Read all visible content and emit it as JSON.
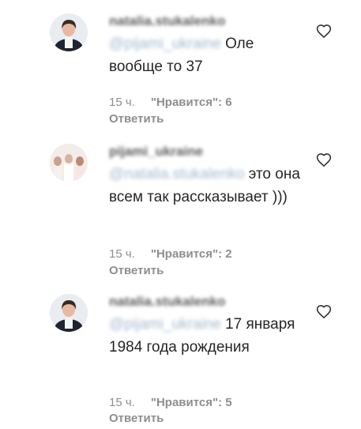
{
  "comments": [
    {
      "username": "natalia.stukalenko",
      "mention": "@pijami_ukraine",
      "text": " Оле вообще то 37",
      "time": "15 ч.",
      "likes": "\"Нравится\": 6",
      "reply": "Ответить",
      "like_icon": "heart-outline-icon"
    },
    {
      "username": "pijami_ukraine",
      "mention": "@natalia.stukalenko",
      "text": " это она всем так рассказывает )))",
      "time": "15 ч.",
      "likes": "\"Нравится\": 2",
      "reply": "Ответить",
      "like_icon": "heart-outline-icon"
    },
    {
      "username": "natalia.stukalenko",
      "mention": "@pijami_ukraine",
      "text": " 17 января 1984 года рождения",
      "time": "15 ч.",
      "likes": "\"Нравится\": 5",
      "reply": "Ответить",
      "like_icon": "heart-outline-icon"
    }
  ]
}
